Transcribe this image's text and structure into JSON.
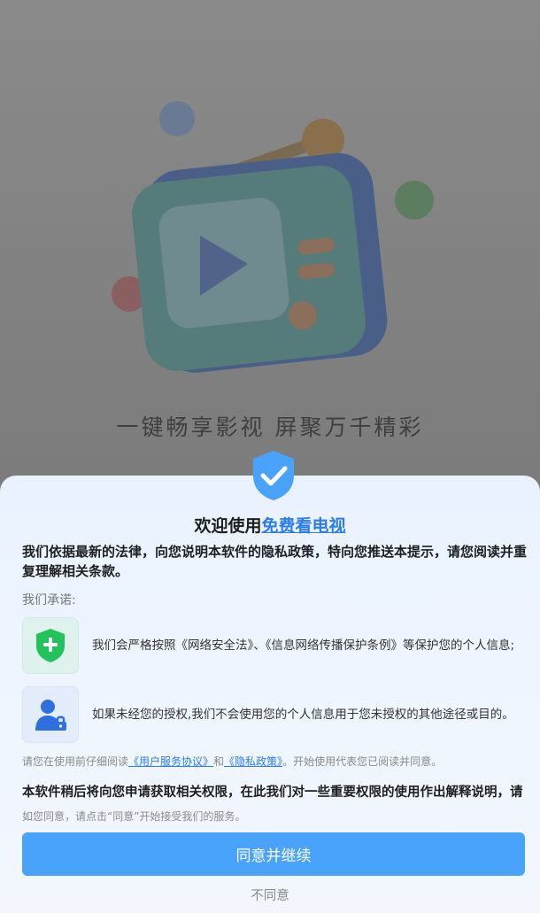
{
  "splash": {
    "slogan": "一键畅享影视  屏聚万千精彩"
  },
  "dialog": {
    "title_prefix": "欢迎使用",
    "app_name": "免费看电视",
    "intro": "我们依据最新的法律，向您说明本软件的隐私政策，特向您推送本提示，请您阅读并重复理解相关条款。",
    "promise_label": "我们承诺:",
    "promises": [
      {
        "icon": "shield-plus-icon",
        "text": "我们会严格按照《网络安全法》、《信息网络传播保护条例》等保护您的个人信息;"
      },
      {
        "icon": "user-lock-icon",
        "text": "如果未经您的授权,我们不会使用您的个人信息用于您未授权的其他途径或目的。"
      }
    ],
    "read_note": {
      "before": "请您在使用前仔细阅读",
      "user_agreement": "《用户服务协议》",
      "and": "和",
      "privacy_policy": "《隐私政策》",
      "after": "。开始使用代表您已阅读并同意。"
    },
    "permission_note": "本软件稍后将向您申请获取相关权限，在此我们对一些重要权限的使用作出解释说明，请",
    "consent_note": "如您同意，请点击“同意”开始接受我们的服务。",
    "agree_button": "同意并继续",
    "disagree_button": "不同意"
  },
  "colors": {
    "accent": "#4aa3fb",
    "link": "#2b7cf0",
    "shield_green": "#22c35a",
    "user_blue": "#2f6fe0"
  }
}
